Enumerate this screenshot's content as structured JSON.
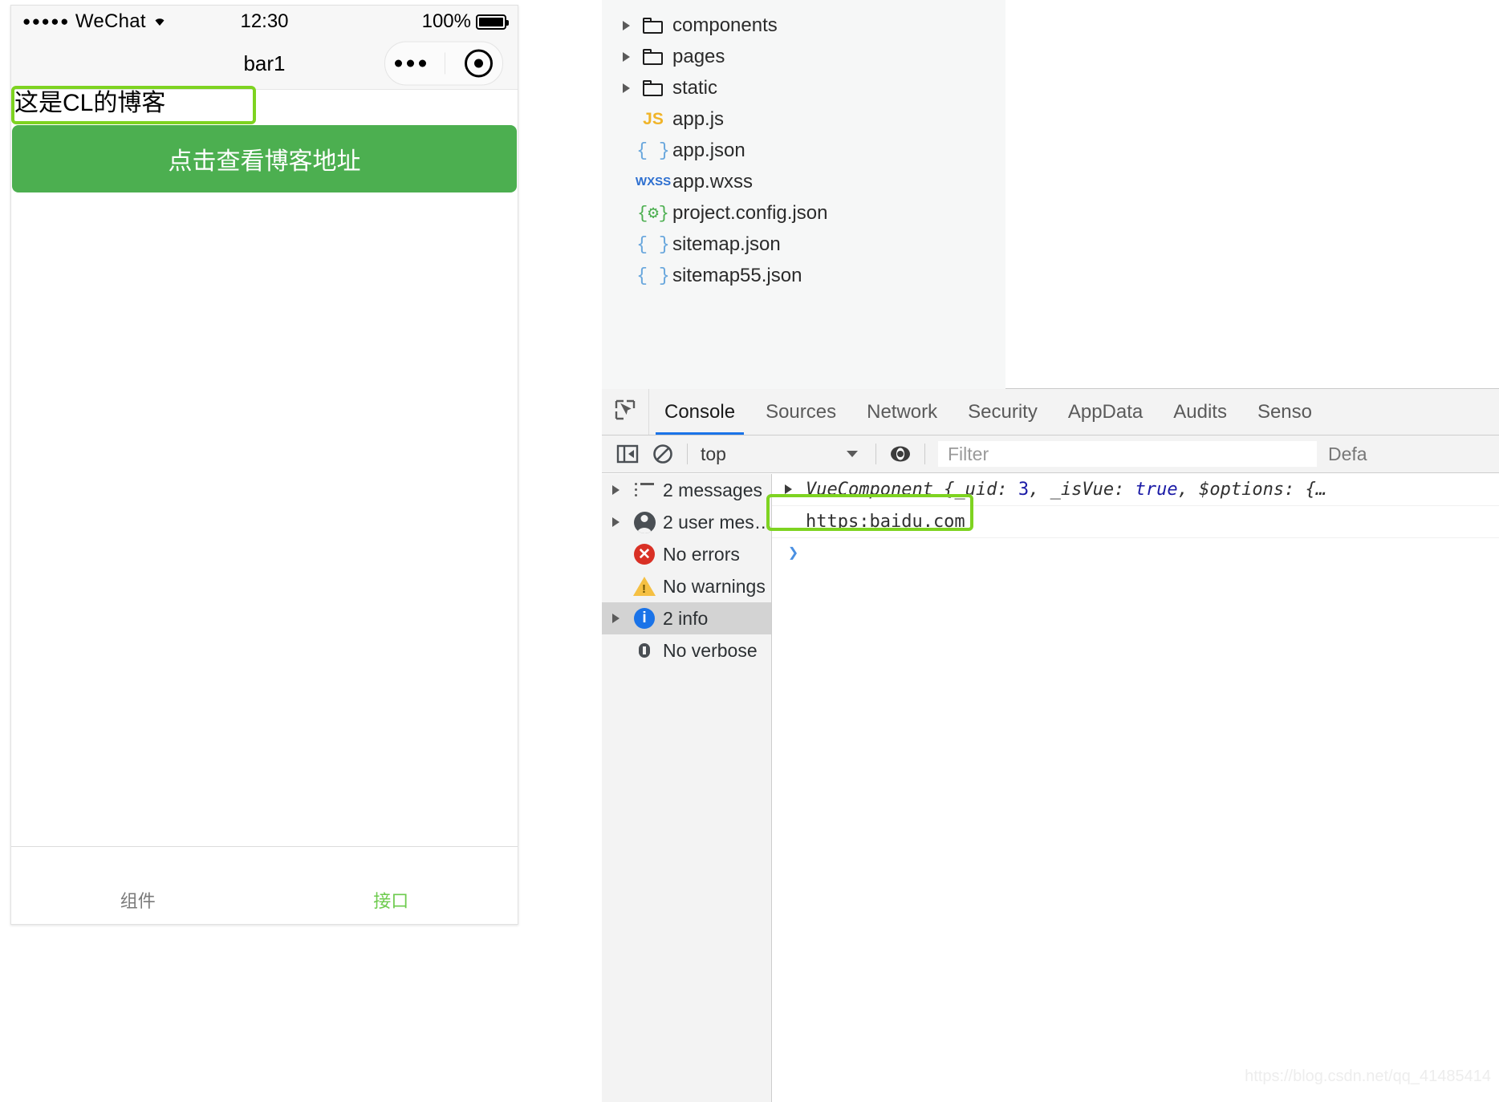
{
  "phone": {
    "status_bar": {
      "signal_dots": "●●●●●",
      "carrier": "WeChat",
      "time": "12:30",
      "battery_percent": "100%"
    },
    "nav": {
      "title": "bar1"
    },
    "content": {
      "blog_text": "这是CL的博客",
      "button_label": "点击查看博客地址"
    },
    "tabbar": [
      {
        "label": "组件",
        "active": false
      },
      {
        "label": "接口",
        "active": true
      }
    ]
  },
  "devtools": {
    "file_tree": [
      {
        "label": "components",
        "icon": "folder-icon",
        "expandable": true
      },
      {
        "label": "pages",
        "icon": "folder-icon",
        "expandable": true
      },
      {
        "label": "static",
        "icon": "folder-icon",
        "expandable": true
      },
      {
        "label": "app.js",
        "icon": "js-icon",
        "icon_text": "JS",
        "expandable": false
      },
      {
        "label": "app.json",
        "icon": "json-icon",
        "icon_text": "{ }",
        "expandable": false
      },
      {
        "label": "app.wxss",
        "icon": "wxss-icon",
        "icon_text": "WXSS",
        "expandable": false
      },
      {
        "label": "project.config.json",
        "icon": "config-json-icon",
        "icon_text": "{⚙}",
        "expandable": false
      },
      {
        "label": "sitemap.json",
        "icon": "json-icon",
        "icon_text": "{ }",
        "expandable": false
      },
      {
        "label": "sitemap55.json",
        "icon": "json-icon",
        "icon_text": "{ }",
        "expandable": false
      }
    ],
    "tabs": [
      {
        "label": "Console",
        "active": true
      },
      {
        "label": "Sources",
        "active": false
      },
      {
        "label": "Network",
        "active": false
      },
      {
        "label": "Security",
        "active": false
      },
      {
        "label": "AppData",
        "active": false
      },
      {
        "label": "Audits",
        "active": false
      },
      {
        "label": "Senso",
        "active": false
      }
    ],
    "toolbar": {
      "context": "top",
      "filter_placeholder": "Filter",
      "levels_label": "Defa"
    },
    "console_sidebar": [
      {
        "label": "2 messages",
        "icon": "list-icon",
        "expandable": true,
        "selected": false
      },
      {
        "label": "2 user mes…",
        "icon": "person-icon",
        "expandable": true,
        "selected": false
      },
      {
        "label": "No errors",
        "icon": "error-icon",
        "expandable": false,
        "selected": false
      },
      {
        "label": "No warnings",
        "icon": "warning-icon",
        "expandable": false,
        "selected": false
      },
      {
        "label": "2 info",
        "icon": "info-icon",
        "expandable": true,
        "selected": true
      },
      {
        "label": "No verbose",
        "icon": "bug-icon",
        "expandable": false,
        "selected": false
      }
    ],
    "console_output": {
      "line1_prefix": "VueComponent {",
      "line1_k1": "_uid",
      "line1_v1": "3",
      "line1_k2": "_isVue",
      "line1_v2": "true",
      "line1_k3": "$options",
      "line1_tail": "{…",
      "line2": "https:baidu.com"
    },
    "watermark": "https://blog.csdn.net/qq_41485414"
  },
  "colors": {
    "highlight_green": "#7ed321",
    "button_green": "#4caf50",
    "accent_blue": "#1a73e8",
    "error_red": "#d93025",
    "warning_yellow": "#f5c043"
  }
}
